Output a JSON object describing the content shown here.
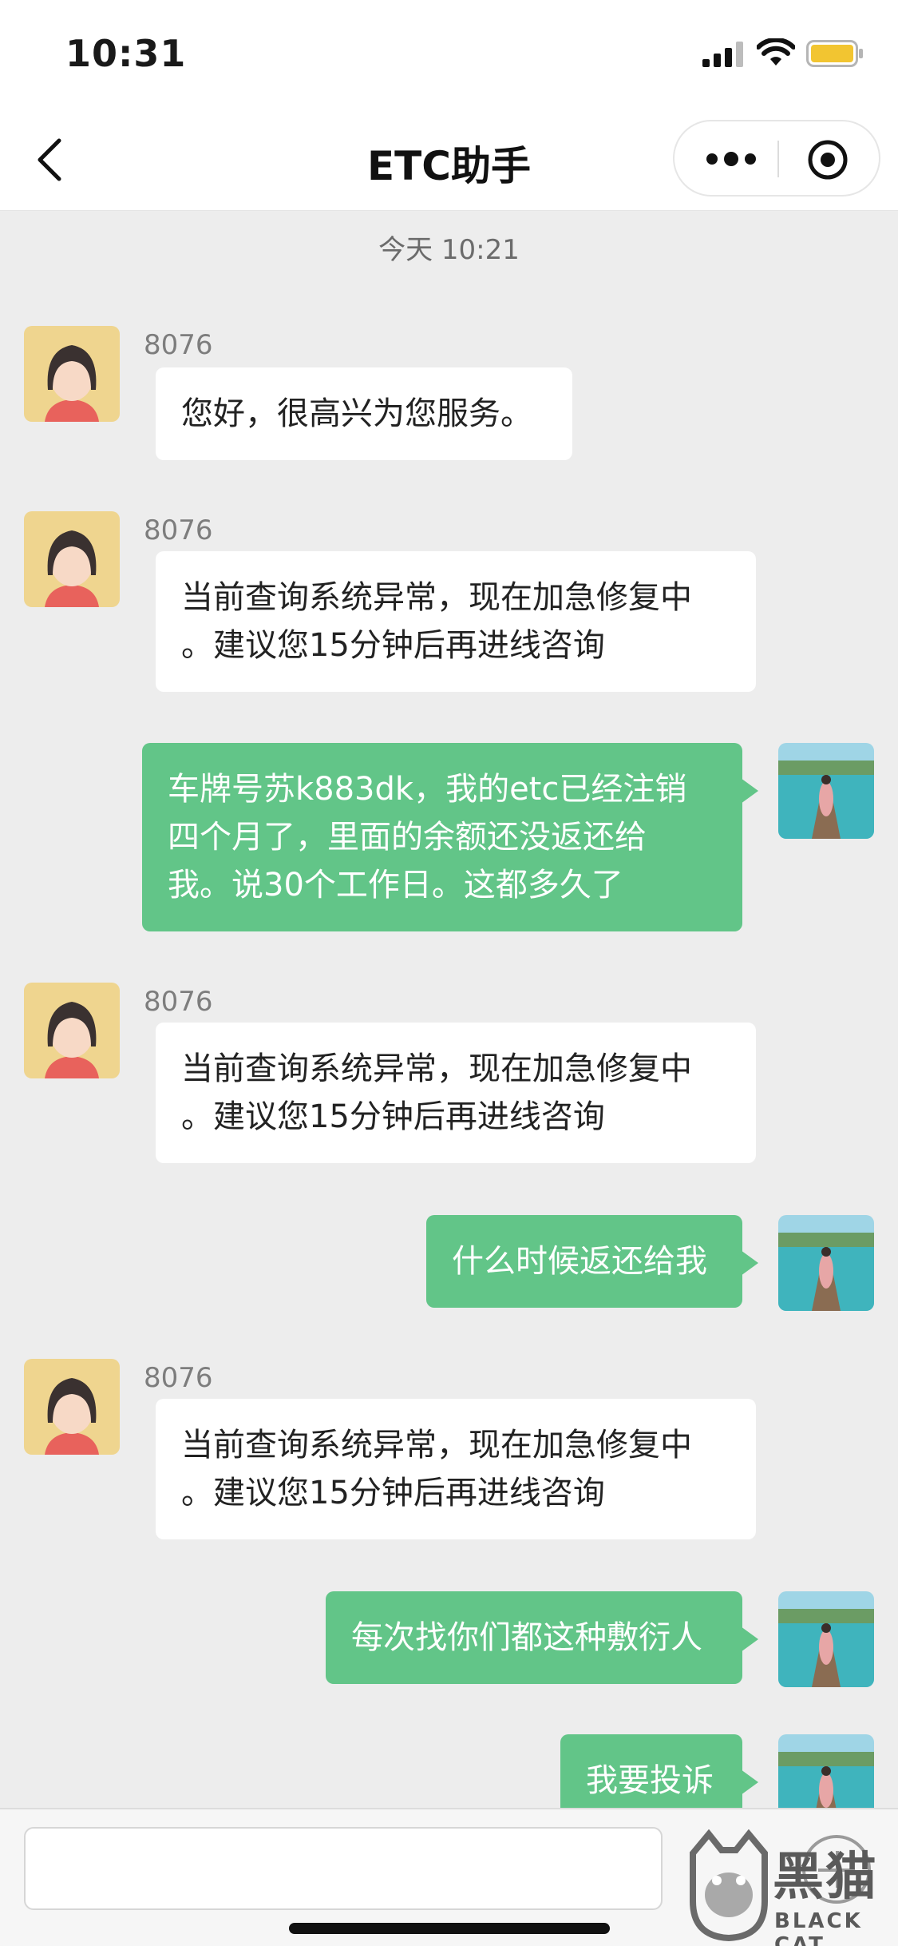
{
  "status_bar": {
    "time": "10:31"
  },
  "nav": {
    "title": "ETC助手"
  },
  "chat": {
    "timestamp": "今天 10:21",
    "messages": [
      {
        "side": "in",
        "sender": "8076",
        "lines": [
          "您好，很高兴为您服务。"
        ]
      },
      {
        "side": "in",
        "sender": "8076",
        "lines": [
          "当前查询系统异常，现在加急修复中",
          "。建议您15分钟后再进线咨询"
        ]
      },
      {
        "side": "out",
        "lines": [
          "车牌号苏k883dk，我的etc已经注销",
          "四个月了，里面的余额还没返还给",
          "我。说30个工作日。这都多久了"
        ]
      },
      {
        "side": "in",
        "sender": "8076",
        "lines": [
          "当前查询系统异常，现在加急修复中",
          "。建议您15分钟后再进线咨询"
        ]
      },
      {
        "side": "out",
        "lines": [
          "什么时候返还给我"
        ]
      },
      {
        "side": "in",
        "sender": "8076",
        "lines": [
          "当前查询系统异常，现在加急修复中",
          "。建议您15分钟后再进线咨询"
        ]
      },
      {
        "side": "out",
        "lines": [
          "每次找你们都这种敷衍人"
        ]
      },
      {
        "side": "out",
        "lines": [
          "我要投诉"
        ]
      }
    ]
  },
  "input": {
    "placeholder": ""
  },
  "watermark": {
    "cn": "黑猫",
    "en": "BLACK CAT"
  },
  "icons": {
    "back": "chevron-left-icon",
    "more": "more-dots-icon",
    "close": "target-circle-icon",
    "add": "plus-circle-icon"
  },
  "colors": {
    "outgoing_bubble": "#62c588",
    "background": "#ededed"
  }
}
